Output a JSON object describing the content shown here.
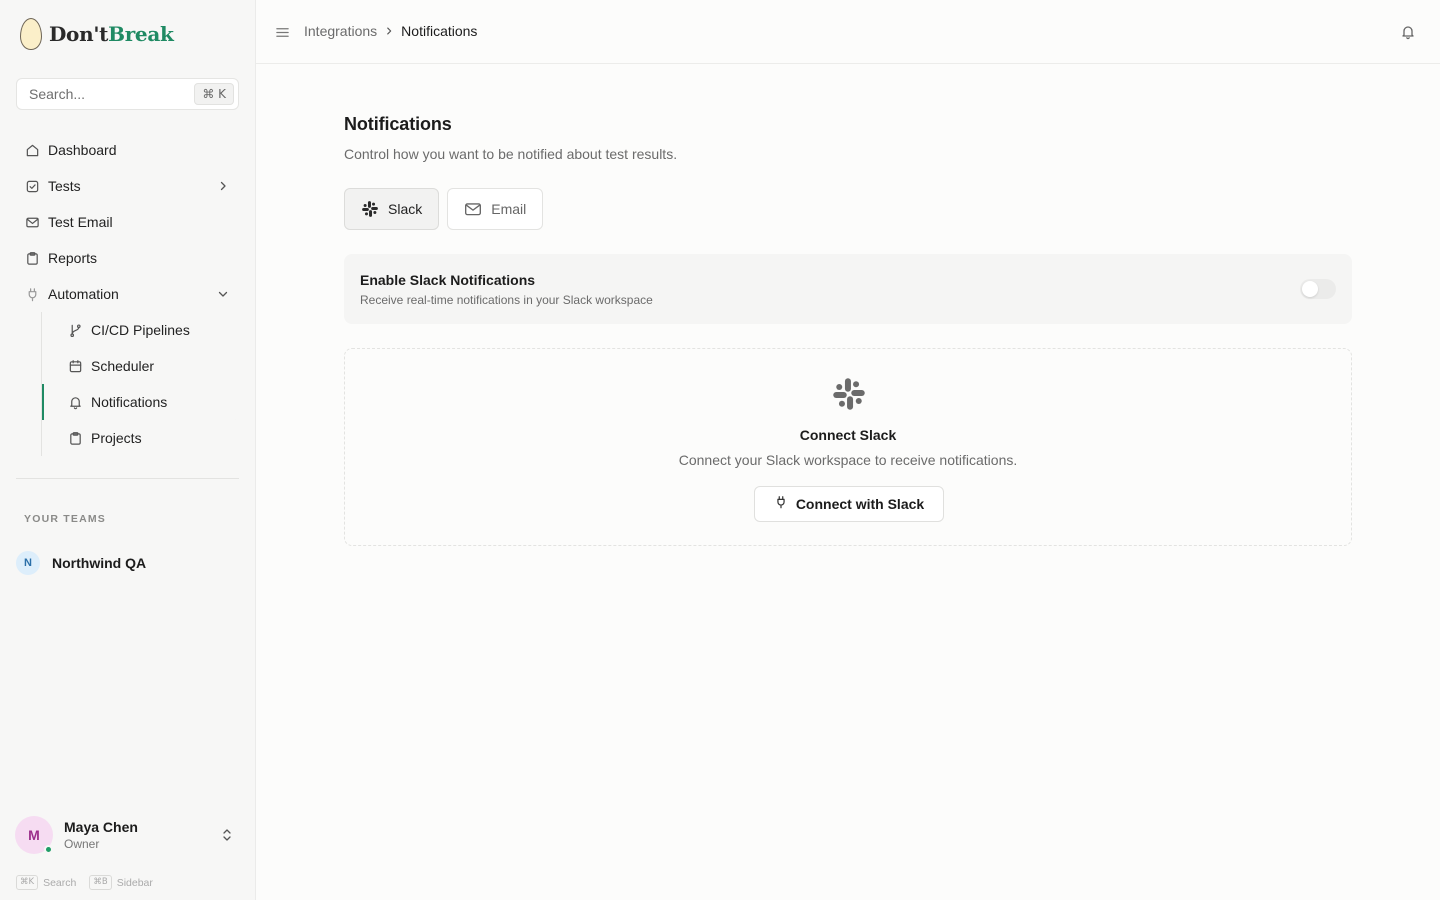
{
  "app": {
    "logo_part1": "Don't",
    "logo_part2": "Break",
    "brand_color": "#1f8a63"
  },
  "search": {
    "placeholder": "Search...",
    "shortcut": "⌘ K"
  },
  "nav": {
    "items": [
      {
        "label": "Dashboard",
        "icon": "home-icon"
      },
      {
        "label": "Tests",
        "icon": "checkbox-icon"
      },
      {
        "label": "Test Email",
        "icon": "mail-icon"
      },
      {
        "label": "Reports",
        "icon": "clipboard-icon"
      },
      {
        "label": "Automation",
        "icon": "plug-icon"
      }
    ],
    "automation_sub": [
      {
        "label": "CI/CD Pipelines",
        "icon": "git-branch-icon"
      },
      {
        "label": "Scheduler",
        "icon": "calendar-icon"
      },
      {
        "label": "Notifications",
        "icon": "bell-icon",
        "active": true
      },
      {
        "label": "Projects",
        "icon": "clipboard-icon"
      }
    ]
  },
  "teams": {
    "heading": "YOUR TEAMS",
    "items": [
      {
        "initial": "N",
        "name": "Northwind QA"
      }
    ]
  },
  "user": {
    "initial": "M",
    "name": "Maya Chen",
    "role": "Owner",
    "status": "online"
  },
  "hints": [
    {
      "key": "⌘K",
      "label": "Search"
    },
    {
      "key": "⌘B",
      "label": "Sidebar"
    }
  ],
  "header": {
    "breadcrumb": [
      "Integrations",
      "Notifications"
    ]
  },
  "main": {
    "title": "Notifications",
    "description": "Control how you want to be notified about test results.",
    "tabs": [
      {
        "label": "Slack",
        "icon": "slack-icon",
        "active": true
      },
      {
        "label": "Email",
        "icon": "mail-icon",
        "active": false
      }
    ],
    "toggle": {
      "title": "Enable Slack Notifications",
      "description": "Receive real-time notifications in your Slack workspace",
      "enabled": false
    },
    "connect": {
      "title": "Connect Slack",
      "description": "Connect your Slack workspace to receive notifications.",
      "button": "Connect with Slack"
    }
  }
}
